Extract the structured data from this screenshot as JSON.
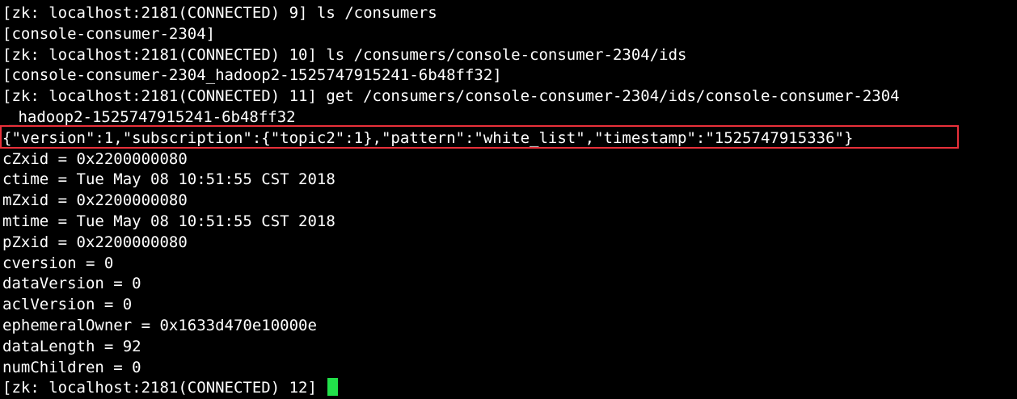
{
  "terminal": {
    "lines": [
      "[zk: localhost:2181(CONNECTED) 9] ls /consumers",
      "[console-consumer-2304]",
      "[zk: localhost:2181(CONNECTED) 10] ls /consumers/console-consumer-2304/ids",
      "[console-consumer-2304_hadoop2-1525747915241-6b48ff32]",
      "[zk: localhost:2181(CONNECTED) 11] get /consumers/console-consumer-2304/ids/console-consumer-2304",
      "_hadoop2-1525747915241-6b48ff32",
      "{\"version\":1,\"subscription\":{\"topic2\":1},\"pattern\":\"white_list\",\"timestamp\":\"1525747915336\"}",
      "cZxid = 0x2200000080",
      "ctime = Tue May 08 10:51:55 CST 2018",
      "mZxid = 0x2200000080",
      "mtime = Tue May 08 10:51:55 CST 2018",
      "pZxid = 0x2200000080",
      "cversion = 0",
      "dataVersion = 0",
      "aclVersion = 0",
      "ephemeralOwner = 0x1633d470e10000e",
      "dataLength = 92",
      "numChildren = 0"
    ],
    "prompt": "[zk: localhost:2181(CONNECTED) 12] ",
    "highlight_color": "#e8303a",
    "cursor_color": "#22e04a",
    "text_color": "#ffffff",
    "background_color": "#000000"
  }
}
